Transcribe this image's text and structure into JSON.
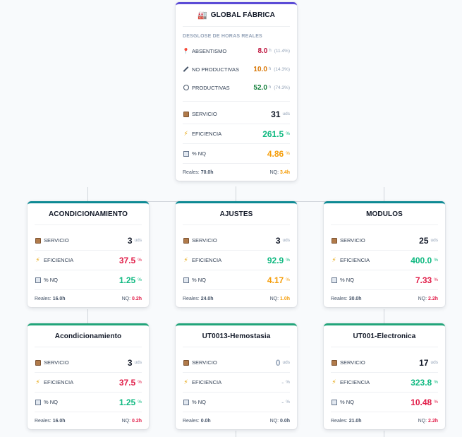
{
  "global": {
    "title": "GLOBAL FÁBRICA",
    "title_icon": "factory-icon",
    "subtitle": "DESGLOSE DE HORAS REALES",
    "hours": [
      {
        "label": "ABSENTISMO",
        "value": "8.0",
        "unit": "h",
        "pct": "(11.4%)",
        "icon": "pin-icon",
        "color": "#be123c"
      },
      {
        "label": "NO PRODUCTIVAS",
        "value": "10.0",
        "unit": "h",
        "pct": "(14.3%)",
        "icon": "wrench-icon",
        "color": "#d97706"
      },
      {
        "label": "PRODUCTIVAS",
        "value": "52.0",
        "unit": "h",
        "pct": "(74.3%)",
        "icon": "gear-icon",
        "color": "#15803d"
      }
    ],
    "servicio": {
      "label": "SERVICIO",
      "value": "31",
      "unit": "uds"
    },
    "eficiencia": {
      "label": "EFICIENCIA",
      "value": "261.5",
      "unit": "%"
    },
    "nq": {
      "label": "% NQ",
      "value": "4.86",
      "unit": "%"
    },
    "footer": {
      "reales_label": "Reales:",
      "reales_value": "70.0h",
      "nq_label": "NQ:",
      "nq_value": "3.4h"
    }
  },
  "areas": [
    {
      "title": "ACONDICIONAMIENTO",
      "servicio": {
        "label": "SERVICIO",
        "value": "3",
        "unit": "uds"
      },
      "eficiencia": {
        "label": "EFICIENCIA",
        "value": "37.5",
        "unit": "%"
      },
      "nq": {
        "label": "% NQ",
        "value": "1.25",
        "unit": "%"
      },
      "footer": {
        "reales_label": "Reales:",
        "reales_value": "16.0h",
        "nq_label": "NQ:",
        "nq_value": "0.2h"
      }
    },
    {
      "title": "AJUSTES",
      "servicio": {
        "label": "SERVICIO",
        "value": "3",
        "unit": "uds"
      },
      "eficiencia": {
        "label": "EFICIENCIA",
        "value": "92.9",
        "unit": "%"
      },
      "nq": {
        "label": "% NQ",
        "value": "4.17",
        "unit": "%"
      },
      "footer": {
        "reales_label": "Reales:",
        "reales_value": "24.0h",
        "nq_label": "NQ:",
        "nq_value": "1.0h"
      }
    },
    {
      "title": "MODULOS",
      "servicio": {
        "label": "SERVICIO",
        "value": "25",
        "unit": "uds"
      },
      "eficiencia": {
        "label": "EFICIENCIA",
        "value": "400.0",
        "unit": "%"
      },
      "nq": {
        "label": "% NQ",
        "value": "7.33",
        "unit": "%"
      },
      "footer": {
        "reales_label": "Reales:",
        "reales_value": "30.0h",
        "nq_label": "NQ:",
        "nq_value": "2.2h"
      }
    }
  ],
  "lines": [
    {
      "title": "Acondicionamiento",
      "servicio": {
        "label": "SERVICIO",
        "value": "3",
        "unit": "uds"
      },
      "eficiencia": {
        "label": "EFICIENCIA",
        "value": "37.5",
        "unit": "%"
      },
      "nq": {
        "label": "% NQ",
        "value": "1.25",
        "unit": "%"
      },
      "footer": {
        "reales_label": "Reales:",
        "reales_value": "16.0h",
        "nq_label": "NQ:",
        "nq_value": "0.2h"
      }
    },
    {
      "title": "UT0013-Hemostasia",
      "servicio": {
        "label": "SERVICIO",
        "value": "0",
        "unit": "uds"
      },
      "eficiencia": {
        "label": "EFICIENCIA",
        "value": "-",
        "unit": "%"
      },
      "nq": {
        "label": "% NQ",
        "value": "-",
        "unit": "%"
      },
      "footer": {
        "reales_label": "Reales:",
        "reales_value": "0.0h",
        "nq_label": "NQ:",
        "nq_value": "0.0h"
      }
    },
    {
      "title": "UT001-Electronica",
      "servicio": {
        "label": "SERVICIO",
        "value": "17",
        "unit": "uds"
      },
      "eficiencia": {
        "label": "EFICIENCIA",
        "value": "323.8",
        "unit": "%"
      },
      "nq": {
        "label": "% NQ",
        "value": "10.48",
        "unit": "%"
      },
      "footer": {
        "reales_label": "Reales:",
        "reales_value": "21.0h",
        "nq_label": "NQ:",
        "nq_value": "2.2h"
      }
    }
  ],
  "colors": {
    "global_accent": "#5b4bd6",
    "area_accent": "#0e8a94",
    "line_accent": "#22a57a",
    "good": "#10b981",
    "warn": "#f59e0b",
    "bad": "#e11d48"
  }
}
